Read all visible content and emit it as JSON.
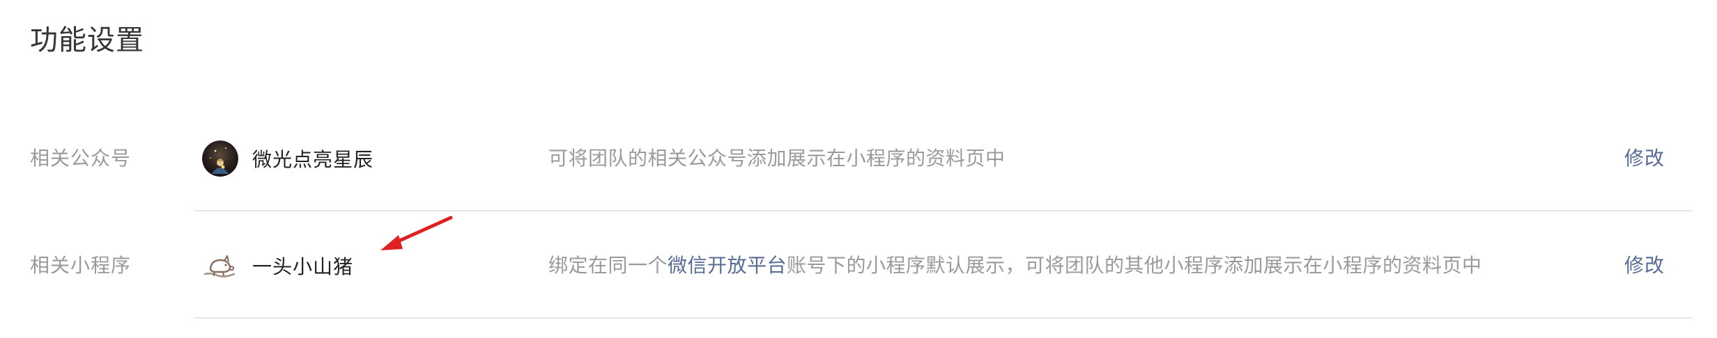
{
  "page": {
    "title": "功能设置"
  },
  "rows": [
    {
      "label": "相关公众号",
      "account_name": "微光点亮星辰",
      "description": "可将团队的相关公众号添加展示在小程序的资料页中",
      "action": "修改"
    },
    {
      "label": "相关小程序",
      "account_name": "一头小山猪",
      "description_prefix": "绑定在同一个",
      "description_link": "微信开放平台",
      "description_suffix": "账号下的小程序默认展示，可将团队的其他小程序添加展示在小程序的资料页中",
      "action": "修改"
    }
  ],
  "colors": {
    "link": "#576b95",
    "label": "#9a9a9a",
    "text": "#222222",
    "divider": "#e7e7eb",
    "annotation_arrow": "#e02020"
  },
  "icons": {
    "row1_avatar": "night-sky-avatar-icon",
    "row2_avatar": "pig-logo-icon",
    "annotation": "red-arrow-icon"
  }
}
